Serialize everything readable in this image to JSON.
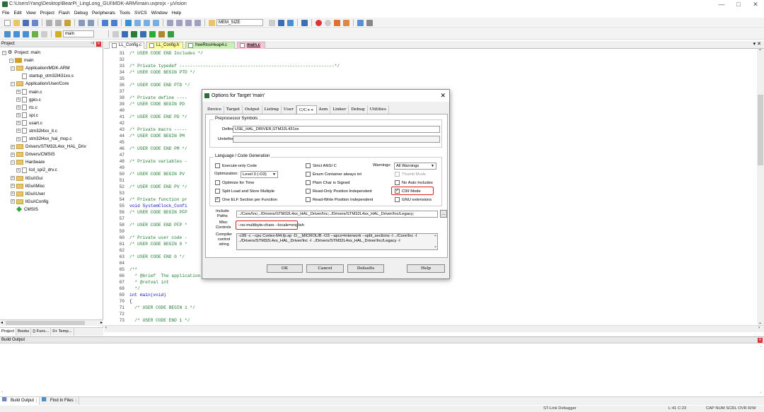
{
  "window": {
    "title": "C:\\Users\\Yang\\Desktop\\BearPi_LingLong_GUI\\MDK-ARM\\main.uvprojx - µVision",
    "minimize": "—",
    "maximize": "□",
    "close": "✕"
  },
  "menu": [
    "File",
    "Edit",
    "View",
    "Project",
    "Flash",
    "Debug",
    "Peripherals",
    "Tools",
    "SVCS",
    "Window",
    "Help"
  ],
  "toolbar": {
    "find_text": "MEM_SIZE",
    "target": "main"
  },
  "project": {
    "header": "Project",
    "root": "Project: main",
    "target": "main",
    "items": [
      {
        "label": "Application/MDK-ARM",
        "indent": 3,
        "kind": "folder",
        "pm": "−"
      },
      {
        "label": "startup_stm32l431xx.s",
        "indent": 5,
        "kind": "file",
        "pm": ""
      },
      {
        "label": "Application/User/Core",
        "indent": 3,
        "kind": "folder",
        "pm": "−"
      },
      {
        "label": "main.c",
        "indent": 5,
        "kind": "file",
        "pm": "+"
      },
      {
        "label": "gpio.c",
        "indent": 5,
        "kind": "file",
        "pm": "+"
      },
      {
        "label": "rtc.c",
        "indent": 5,
        "kind": "file",
        "pm": "+"
      },
      {
        "label": "spi.c",
        "indent": 5,
        "kind": "file",
        "pm": "+"
      },
      {
        "label": "usart.c",
        "indent": 5,
        "kind": "file",
        "pm": "+"
      },
      {
        "label": "stm32l4xx_it.c",
        "indent": 5,
        "kind": "file",
        "pm": "+"
      },
      {
        "label": "stm32l4xx_hal_msp.c",
        "indent": 5,
        "kind": "file",
        "pm": "+"
      },
      {
        "label": "Drivers/STM32L4xx_HAL_Driv",
        "indent": 3,
        "kind": "folder",
        "pm": "+"
      },
      {
        "label": "Drivers/CMSIS",
        "indent": 3,
        "kind": "folder",
        "pm": "+"
      },
      {
        "label": "Hardware",
        "indent": 3,
        "kind": "folder",
        "pm": "−"
      },
      {
        "label": "lcd_spi2_drv.c",
        "indent": 5,
        "kind": "file",
        "pm": "+"
      },
      {
        "label": "llGui\\Gui",
        "indent": 3,
        "kind": "folder",
        "pm": "+"
      },
      {
        "label": "llGui\\Misc",
        "indent": 3,
        "kind": "folder",
        "pm": "+"
      },
      {
        "label": "llGui\\User",
        "indent": 3,
        "kind": "folder",
        "pm": "+"
      },
      {
        "label": "llGui\\Config",
        "indent": 3,
        "kind": "folder",
        "pm": "+"
      },
      {
        "label": "CMSIS",
        "indent": 3,
        "kind": "gem",
        "pm": ""
      }
    ],
    "tabs": [
      "Project",
      "Books",
      "{} Func...",
      "0+ Temp..."
    ]
  },
  "editor": {
    "tabs": [
      "LL_Config.c",
      "LL_Config.h",
      "freeRtosHeap4.c",
      "main.c"
    ],
    "lines": [
      {
        "n": "31",
        "t": "/* USER CODE END Includes */",
        "c": "cm"
      },
      {
        "n": "32",
        "t": "",
        "c": "cm"
      },
      {
        "n": "33",
        "t": "/* Private typedef -----------------------------------------------------------*/",
        "c": "cm"
      },
      {
        "n": "34",
        "t": "/* USER CODE BEGIN PTD */",
        "c": "cm"
      },
      {
        "n": "35",
        "t": "",
        "c": "cm"
      },
      {
        "n": "36",
        "t": "/* USER CODE END PTD */",
        "c": "cm"
      },
      {
        "n": "37",
        "t": "",
        "c": "cm"
      },
      {
        "n": "38",
        "t": "/* Private define ----",
        "c": "cm"
      },
      {
        "n": "39",
        "t": "/* USER CODE BEGIN PD",
        "c": "cm"
      },
      {
        "n": "40",
        "t": "",
        "c": "cm"
      },
      {
        "n": "41",
        "t": "/* USER CODE END PD */",
        "c": "cm"
      },
      {
        "n": "42",
        "t": "",
        "c": "cm"
      },
      {
        "n": "43",
        "t": "/* Private macro -----",
        "c": "cm"
      },
      {
        "n": "44",
        "t": "/* USER CODE BEGIN PM",
        "c": "cm"
      },
      {
        "n": "45",
        "t": "",
        "c": "cm"
      },
      {
        "n": "46",
        "t": "/* USER CODE END PM */",
        "c": "cm"
      },
      {
        "n": "47",
        "t": "",
        "c": "cm"
      },
      {
        "n": "48",
        "t": "/* Private variables -",
        "c": "cm"
      },
      {
        "n": "49",
        "t": "",
        "c": "cm"
      },
      {
        "n": "50",
        "t": "/* USER CODE BEGIN PV",
        "c": "cm"
      },
      {
        "n": "51",
        "t": "",
        "c": "cm"
      },
      {
        "n": "52",
        "t": "/* USER CODE END PV */",
        "c": "cm"
      },
      {
        "n": "53",
        "t": "",
        "c": "cm"
      },
      {
        "n": "54",
        "t": "/* Private function pr",
        "c": "cm"
      },
      {
        "n": "55",
        "t": "void SystemClock_Confi",
        "c": "kw"
      },
      {
        "n": "56",
        "t": "/* USER CODE BEGIN PFP",
        "c": "cm"
      },
      {
        "n": "57",
        "t": "",
        "c": "cm"
      },
      {
        "n": "58",
        "t": "/* USER CODE END PFP *",
        "c": "cm"
      },
      {
        "n": "59",
        "t": "",
        "c": "cm"
      },
      {
        "n": "60",
        "t": "/* Private user code -",
        "c": "cm"
      },
      {
        "n": "61",
        "t": "/* USER CODE BEGIN 0 *",
        "c": "cm"
      },
      {
        "n": "62",
        "t": "",
        "c": "cm"
      },
      {
        "n": "63",
        "t": "/* USER CODE END 0 */",
        "c": "cm"
      },
      {
        "n": "64",
        "t": "",
        "c": "cm"
      },
      {
        "n": "65",
        "t": "/**",
        "c": "cm"
      },
      {
        "n": "66",
        "t": "  * @brief  The application entry point.",
        "c": "cm"
      },
      {
        "n": "67",
        "t": "  * @retval int",
        "c": "cm"
      },
      {
        "n": "68",
        "t": "  */",
        "c": "cm"
      },
      {
        "n": "69",
        "t": "int main(void)",
        "c": "kw"
      },
      {
        "n": "70",
        "t": "{",
        "c": "fn"
      },
      {
        "n": "71",
        "t": "  /* USER CODE BEGIN 1 */",
        "c": "cm"
      },
      {
        "n": "72",
        "t": "",
        "c": "cm"
      },
      {
        "n": "73",
        "t": "  /* USER CODE END 1 */",
        "c": "cm"
      }
    ]
  },
  "dialog": {
    "title": "Options for Target 'main'",
    "close": "✕",
    "tabs": [
      "Device",
      "Target",
      "Output",
      "Listing",
      "User",
      "C/C++",
      "Asm",
      "Linker",
      "Debug",
      "Utilities"
    ],
    "active_tab": "C/C++",
    "preproc": {
      "title": "Preprocessor Symbols",
      "define_label": "Define:",
      "define_value": "USE_HAL_DRIVER,STM32L431xx",
      "undefine_label": "Undefine:",
      "undefine_value": ""
    },
    "lang": {
      "title": "Language / Code Generation",
      "execute_only": "Execute-only Code",
      "strict_ansi": "Strict ANSI C",
      "warnings_label": "Warnings:",
      "warnings_value": "All Warnings",
      "opt_label": "Optimization:",
      "opt_value": "Level 3 (-O3)",
      "enum_container": "Enum Container always int",
      "thumb_mode": "Thumb Mode",
      "optimize_time": "Optimize for Time",
      "plain_char": "Plain Char is Signed",
      "no_auto_includes": "No Auto Includes",
      "split_load": "Split Load and Store Multiple",
      "read_only_pos": "Read-Only Position Independent",
      "c99_mode": "C99 Mode",
      "one_elf": "One ELF Section per Function",
      "read_write_pos": "Read-Write Position Independent",
      "gnu_ext": "GNU extensions"
    },
    "include_label": "Include\nPaths",
    "include_value": "../Core/Inc;../Drivers/STM32L4xx_HAL_Driver/Inc;../Drivers/STM32L4xx_HAL_Driver/Inc/Legacy;",
    "misc_label": "Misc\nControls",
    "misc_value": "--no-multibyte-chars --locale=english",
    "compiler_label": "Compiler\ncontrol\nstring",
    "compiler_line1": "-c99 -c --cpu Cortex-M4.fp.sp -D__MICROLIB -O3 --apcs=interwork --split_sections -I ../Core/Inc -I",
    "compiler_line2": "../Drivers/STM32L4xx_HAL_Driver/Inc -I ../Drivers/STM32L4xx_HAL_Driver/Inc/Legacy -I",
    "buttons": {
      "ok": "OK",
      "cancel": "Cancel",
      "defaults": "Defaults",
      "help": "Help"
    },
    "highlight_color": "#e02020"
  },
  "build": {
    "header": "Build Output",
    "tabs": [
      "Build Output",
      "Find In Files"
    ]
  },
  "status": {
    "debugger": "ST-Link Debugger",
    "position": "L:41 C:23",
    "flags": "CAP  NUM  SCRL  OVR  R/W"
  }
}
